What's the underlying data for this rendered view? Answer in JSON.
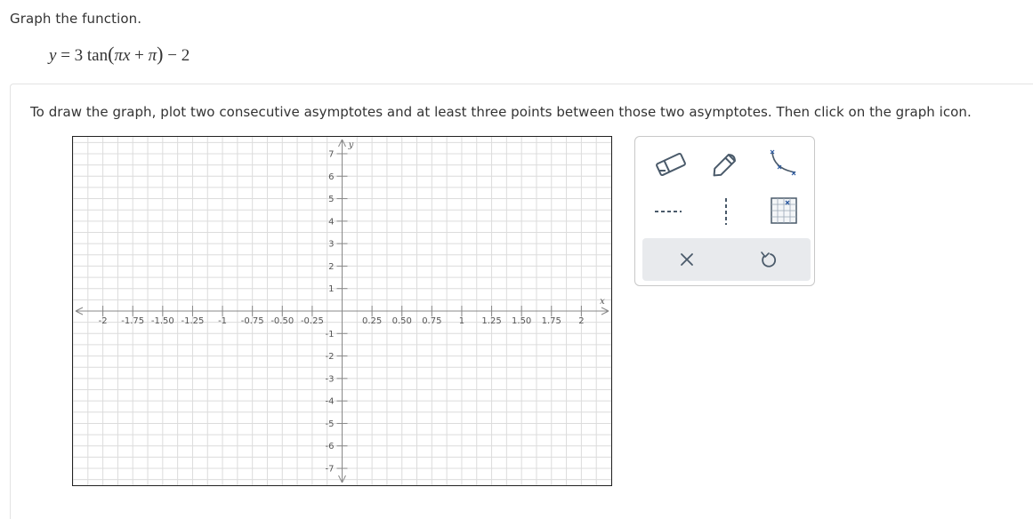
{
  "prompt": "Graph the function.",
  "equation": {
    "lhs": "y",
    "eq": "=",
    "coef": "3 tan",
    "pi1": "π",
    "x": "x",
    "plus": "+",
    "pi2": "π",
    "tail": "− 2"
  },
  "instructions": "To draw the graph, plot two consecutive asymptotes and at least three points between those two asymptotes. Then click on the graph icon.",
  "graph": {
    "x_label": "x",
    "y_label": "y",
    "x_range": [
      -2.25,
      2.25
    ],
    "y_range": [
      -7.75,
      7.75
    ],
    "x_ticks": [
      {
        "value": -2,
        "label": "-2"
      },
      {
        "value": -1.75,
        "label": "-1.75"
      },
      {
        "value": -1.5,
        "label": "-1.50"
      },
      {
        "value": -1.25,
        "label": "-1.25"
      },
      {
        "value": -1,
        "label": "-1"
      },
      {
        "value": -0.75,
        "label": "-0.75"
      },
      {
        "value": -0.5,
        "label": "-0.50"
      },
      {
        "value": -0.25,
        "label": "-0.25"
      },
      {
        "value": 0.25,
        "label": "0.25"
      },
      {
        "value": 0.5,
        "label": "0.50"
      },
      {
        "value": 0.75,
        "label": "0.75"
      },
      {
        "value": 1,
        "label": "1"
      },
      {
        "value": 1.25,
        "label": "1.25"
      },
      {
        "value": 1.5,
        "label": "1.50"
      },
      {
        "value": 1.75,
        "label": "1.75"
      },
      {
        "value": 2,
        "label": "2"
      }
    ],
    "y_ticks": [
      {
        "value": 7,
        "label": "7"
      },
      {
        "value": 6,
        "label": "6"
      },
      {
        "value": 5,
        "label": "5"
      },
      {
        "value": 4,
        "label": "4"
      },
      {
        "value": 3,
        "label": "3"
      },
      {
        "value": 2,
        "label": "2"
      },
      {
        "value": 1,
        "label": "1"
      },
      {
        "value": -1,
        "label": "-1"
      },
      {
        "value": -2,
        "label": "-2"
      },
      {
        "value": -3,
        "label": "-3"
      },
      {
        "value": -4,
        "label": "-4"
      },
      {
        "value": -5,
        "label": "-5"
      },
      {
        "value": -6,
        "label": "-6"
      },
      {
        "value": -7,
        "label": "-7"
      }
    ]
  },
  "toolbox": {
    "tools": [
      {
        "name": "eraser-tool",
        "icon": "eraser-icon"
      },
      {
        "name": "pencil-tool",
        "icon": "pencil-icon"
      },
      {
        "name": "tangent-curve-tool",
        "icon": "tangent-curve-icon"
      },
      {
        "name": "horizontal-asymptote-tool",
        "icon": "horizontal-dashed-line-icon"
      },
      {
        "name": "vertical-asymptote-tool",
        "icon": "vertical-dashed-line-icon"
      },
      {
        "name": "graph-tool",
        "icon": "graph-grid-icon"
      }
    ],
    "actions": [
      {
        "name": "clear-button",
        "icon": "close-icon"
      },
      {
        "name": "undo-button",
        "icon": "undo-icon"
      }
    ]
  },
  "colors": {
    "grid": "#dcdcdc",
    "axis": "#888888",
    "text": "#333333",
    "icon": "#4a5a6a",
    "toolbox_border": "#c8c8c8",
    "action_bar": "#e8eaed"
  }
}
